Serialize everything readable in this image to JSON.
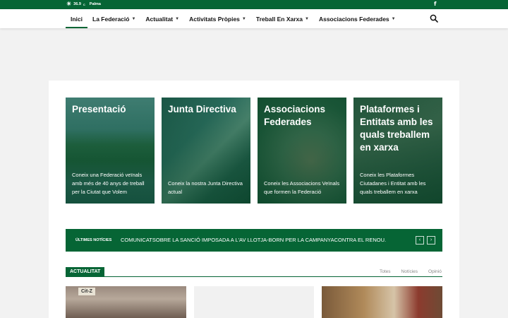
{
  "topbar": {
    "temperature": "36.9",
    "unit": "C",
    "city": "Palma",
    "weather_icon": "sun-icon",
    "social_icon": "facebook-icon"
  },
  "nav": {
    "items": [
      {
        "label": "Inici",
        "dropdown": false,
        "active": true
      },
      {
        "label": "La Federació",
        "dropdown": true
      },
      {
        "label": "Actualitat",
        "dropdown": true
      },
      {
        "label": "Activitats Pròpies",
        "dropdown": true
      },
      {
        "label": "Treball En Xarxa",
        "dropdown": true
      },
      {
        "label": "Associacions Federades",
        "dropdown": true
      }
    ],
    "search_icon": "search-icon"
  },
  "cards": [
    {
      "title": "Presentació",
      "desc": "Coneix una Federació veïnals amb més de 40 anys de treball per la Ciutat que Volem"
    },
    {
      "title": "Junta Directiva",
      "desc": "Coneix la nostra Junta Directiva actual"
    },
    {
      "title": "Associacions Federades",
      "desc": "Coneix les Associacions Veïnals que formen la Federació"
    },
    {
      "title": "Plataformes i Entitats amb les quals treballem en xarxa",
      "desc": "Coneix les Plataformes Ciutadanes i Entitat amb les quals treballem en xarxa"
    }
  ],
  "ticker": {
    "label": "ÚLTIMES NOTÍCIES",
    "headline": "COMUNICATSOBRE LA SANCIÓ IMPOSADA A L'AV LLOTJA-BORN PER LA CAMPANYACONTRA EL RENOU.",
    "prev": "‹",
    "next": "›"
  },
  "section": {
    "title": "ACTUALITAT",
    "filters": [
      "Totes",
      "Notícies",
      "Opinió"
    ]
  },
  "thumb_badge": "Cit-Z",
  "colors": {
    "brand": "#066535"
  }
}
